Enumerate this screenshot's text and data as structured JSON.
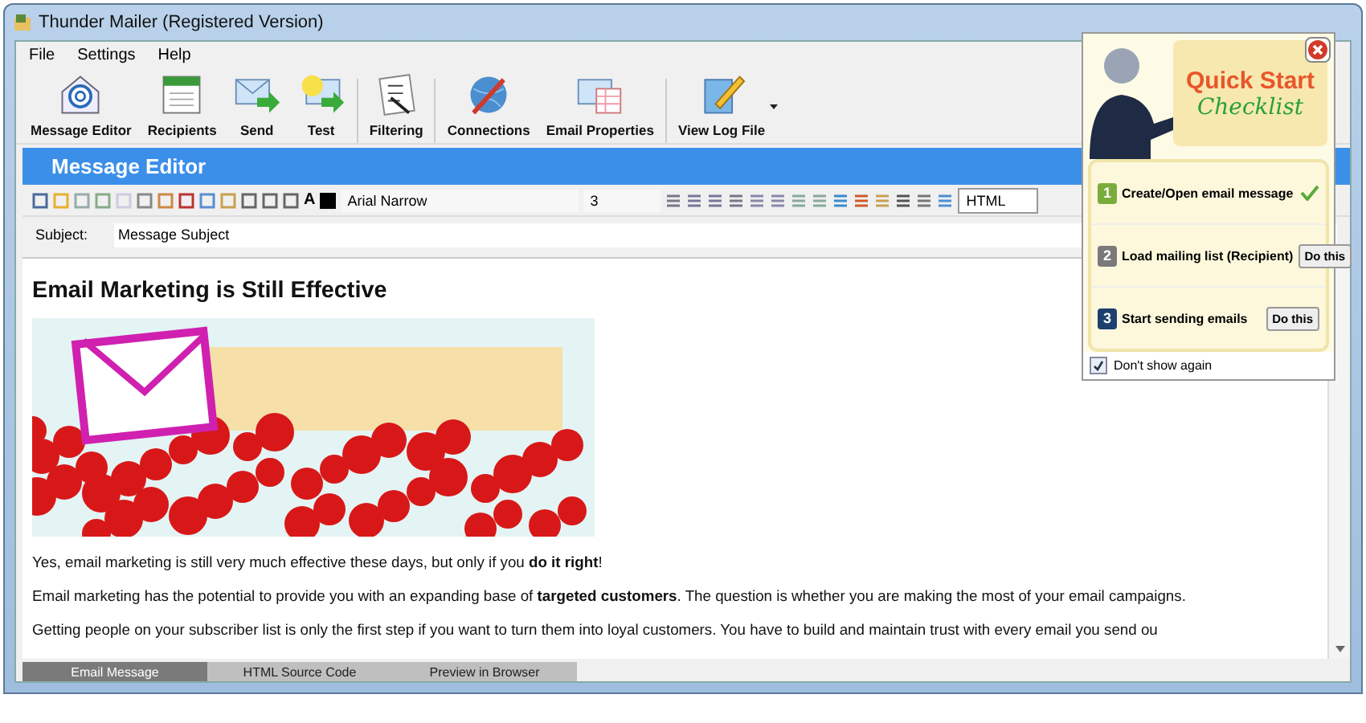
{
  "window": {
    "title": "Thunder Mailer (Registered Version)"
  },
  "menu": [
    "File",
    "Settings",
    "Help"
  ],
  "toolbar": [
    {
      "label": "Message Editor",
      "dropdown": false
    },
    {
      "label": "Recipients",
      "dropdown": false
    },
    {
      "label": "Send",
      "dropdown": false
    },
    {
      "label": "Test",
      "dropdown": false
    },
    {
      "label": "Filtering",
      "dropdown": false
    },
    {
      "label": "Connections",
      "dropdown": false
    },
    {
      "label": "Email Properties",
      "dropdown": false
    },
    {
      "label": "View Log File",
      "dropdown": true
    }
  ],
  "panel": {
    "title": "Message Editor"
  },
  "format_bar": {
    "color_letter": "A",
    "font": "Arial Narrow",
    "size": "3",
    "mode": "HTML"
  },
  "subject": {
    "label": "Subject:",
    "value": "Message Subject"
  },
  "document": {
    "heading": "Email Marketing is Still Effective",
    "paragraphs": [
      "Yes, email marketing is still very much effective these days, but only if you **do it right**!",
      "Email marketing has the potential to provide you with an expanding base of **targeted customers**. The question is whether you are making the most of your email campaigns.",
      "Getting people on your subscriber list is only the first step if you want to turn them into loyal customers. You have to build and maintain trust with every email you send ou"
    ]
  },
  "bottom_tabs": [
    {
      "label": "Email Message",
      "selected": true
    },
    {
      "label": "HTML Source Code",
      "selected": false
    },
    {
      "label": "Preview in Browser",
      "selected": false
    }
  ],
  "quick_start": {
    "title": "Quick Start",
    "subtitle": "Checklist",
    "steps": [
      {
        "number": "1",
        "label": "Create/Open email message",
        "color": "#7aac3c",
        "done": true
      },
      {
        "number": "2",
        "label": "Load mailing list (Recipient)",
        "color": "#7a7a7a",
        "done": false,
        "action": "Do this"
      },
      {
        "number": "3",
        "label": "Start sending emails",
        "color": "#1f3f6e",
        "done": false,
        "action": "Do this"
      }
    ],
    "dont_show": {
      "label": "Don't show again",
      "checked": true
    }
  }
}
